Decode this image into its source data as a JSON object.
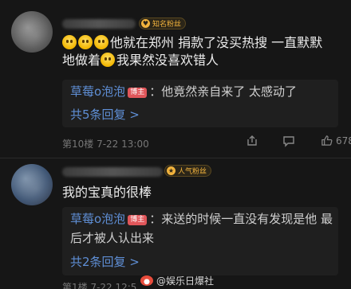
{
  "comment_1": {
    "badge": "知名粉丝",
    "text_line1": "他就在郑州 捐款了没买热搜 一直默默",
    "text_line2_a": "地做着",
    "text_line2_b": "我果然没喜欢错人",
    "reply": {
      "author": "草莓o泡泡",
      "op_label": "博主",
      "text": "：他竟然亲自来了 太感动了",
      "more": "共5条回复 >"
    },
    "meta": "第10楼  7-22 13:00",
    "like_count": "678"
  },
  "comment_2": {
    "badge": "人气粉丝",
    "text": "我的宝真的很棒",
    "reply": {
      "author": "草莓o泡泡",
      "op_label": "博主",
      "text_l1": "：来送的时候一直没有发现是他 最",
      "text_l2": "后才被人认出来",
      "more": "共2条回复 >"
    },
    "meta": "第1楼  7-22 12:5"
  },
  "watermark": "@娱乐日爆社",
  "colors": {
    "background": "#161616",
    "link": "#5f8fd6",
    "op_badge": "#e0565a",
    "fan_badge": "#f2b33d"
  },
  "icons": [
    "share-icon",
    "comment-icon",
    "thumbs-up-icon",
    "weibo-icon"
  ]
}
